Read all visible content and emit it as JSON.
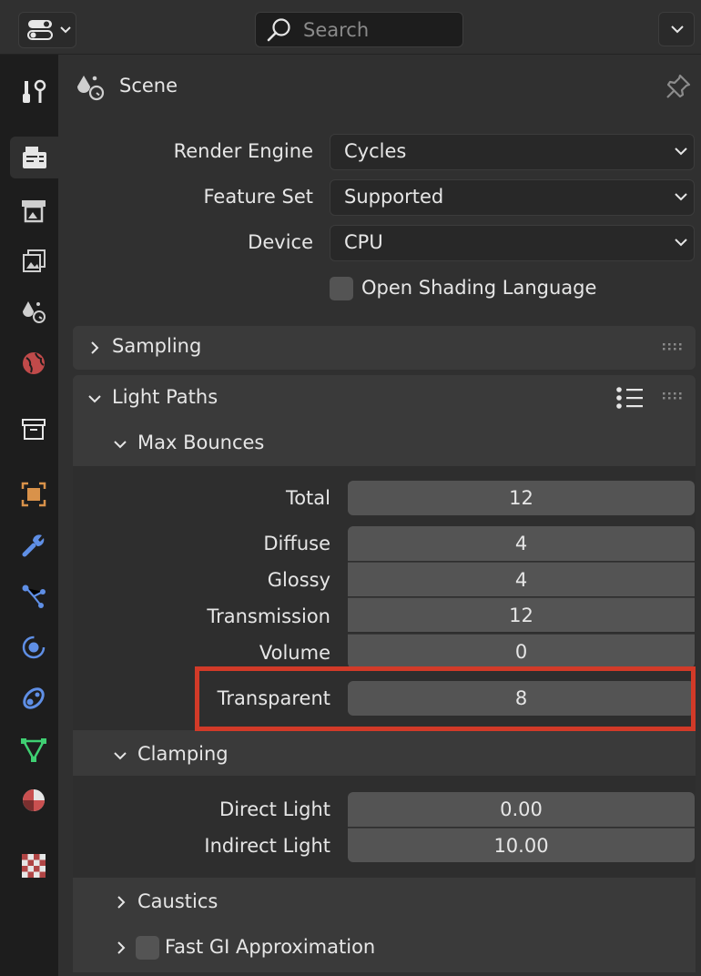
{
  "header": {
    "editor_type_icon": "properties-editor-icon",
    "search_placeholder": "Search",
    "menu_icon": "chevron-down-icon"
  },
  "tabs": [
    {
      "name": "tool-icon"
    },
    {
      "name": "render-icon",
      "active": true
    },
    {
      "name": "output-icon"
    },
    {
      "name": "view-layer-icon"
    },
    {
      "name": "scene-icon"
    },
    {
      "name": "world-icon"
    },
    {
      "name": "collection-icon"
    },
    {
      "name": "object-icon"
    },
    {
      "name": "modifier-icon"
    },
    {
      "name": "particles-icon"
    },
    {
      "name": "physics-icon"
    },
    {
      "name": "constraints-icon"
    },
    {
      "name": "data-icon"
    },
    {
      "name": "material-icon"
    },
    {
      "name": "texture-icon"
    }
  ],
  "context": {
    "title": "Scene",
    "icon": "scene-icon",
    "pin_icon": "pin-icon"
  },
  "render": {
    "engine_label": "Render Engine",
    "engine_value": "Cycles",
    "feature_set_label": "Feature Set",
    "feature_set_value": "Supported",
    "device_label": "Device",
    "device_value": "CPU",
    "osl_label": "Open Shading Language",
    "osl_checked": false
  },
  "panels": {
    "sampling_title": "Sampling",
    "light_paths_title": "Light Paths",
    "max_bounces_title": "Max Bounces",
    "clamping_title": "Clamping",
    "caustics_title": "Caustics",
    "fast_gi_title": "Fast GI Approximation",
    "fast_gi_checked": false
  },
  "max_bounces": {
    "total_label": "Total",
    "total": "12",
    "diffuse_label": "Diffuse",
    "diffuse": "4",
    "glossy_label": "Glossy",
    "glossy": "4",
    "transmission_label": "Transmission",
    "transmission": "12",
    "volume_label": "Volume",
    "volume": "0",
    "transparent_label": "Transparent",
    "transparent": "8"
  },
  "clamping": {
    "direct_label": "Direct Light",
    "direct": "0.00",
    "indirect_label": "Indirect Light",
    "indirect": "10.00"
  },
  "colors": {
    "highlight": "#d23a28",
    "background": "#303030",
    "field": "#545454"
  }
}
